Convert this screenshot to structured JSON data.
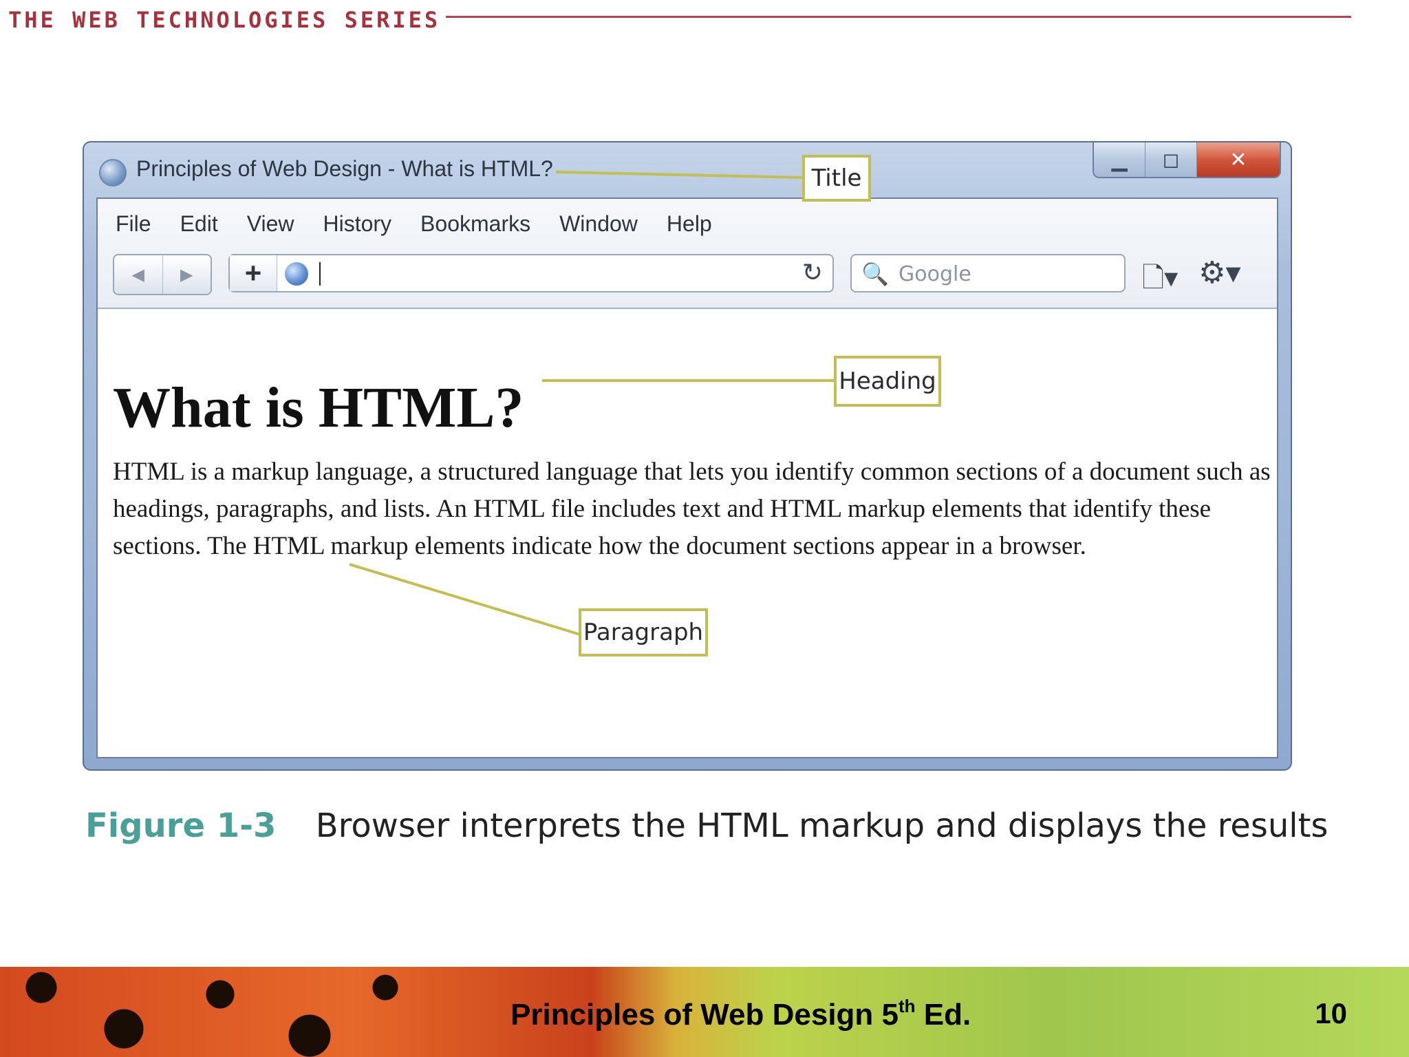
{
  "series": {
    "title": "THE WEB TECHNOLOGIES SERIES"
  },
  "window": {
    "title": "Principles of Web Design - What is HTML?",
    "controls": {
      "minimize": "▁",
      "maximize": "◻",
      "close": "✕"
    }
  },
  "menu": [
    "File",
    "Edit",
    "View",
    "History",
    "Bookmarks",
    "Window",
    "Help"
  ],
  "toolbar": {
    "back": "◀",
    "forward": "▶",
    "add_tab": "+",
    "reload": "↻",
    "search_icon": "🔍",
    "search_placeholder": "Google",
    "page_menu": "🗋▾",
    "settings_menu": "⚙▾"
  },
  "page": {
    "heading": "What is HTML?",
    "paragraph": "HTML is a markup language, a structured language that lets you identify common sections of a document such as headings, paragraphs, and lists. An HTML file includes text and HTML markup elements that identify these sections. The HTML markup elements indicate how the document sections appear in a browser."
  },
  "callouts": {
    "title": "Title",
    "heading": "Heading",
    "paragraph": "Paragraph"
  },
  "caption": {
    "label": "Figure 1-3",
    "text": "Browser interprets the HTML markup and displays the results"
  },
  "footer": {
    "title": "Principles of Web Design 5",
    "title_sup": "th",
    "title_suffix": " Ed.",
    "page": "10"
  },
  "colors": {
    "accent_red": "#a8323b",
    "callout_border": "#c3be51",
    "caption_teal": "#4a9f98"
  }
}
